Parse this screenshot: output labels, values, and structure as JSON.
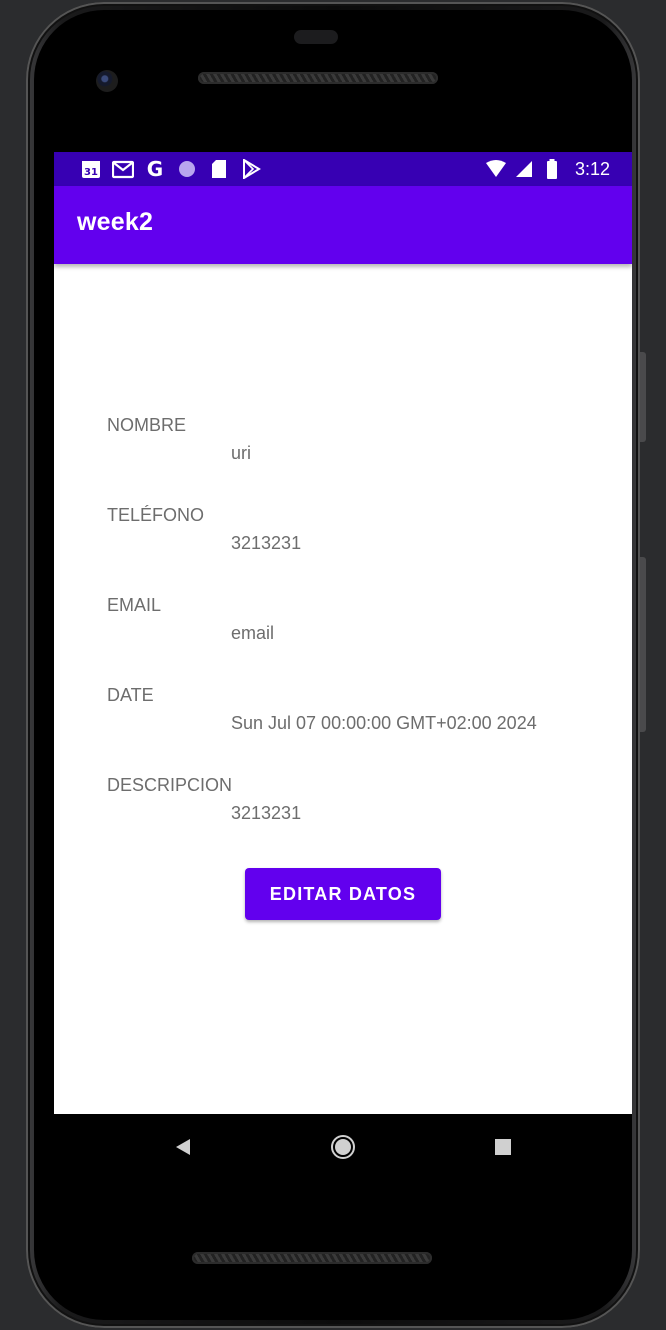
{
  "status_bar": {
    "time": "3:12",
    "left_icons": [
      "calendar-icon",
      "gmail-icon",
      "google-icon",
      "dot-icon",
      "sd-card-icon",
      "play-store-icon"
    ],
    "right_icons": [
      "wifi-icon",
      "signal-icon",
      "battery-icon"
    ],
    "google_letter": "G",
    "calendar_day": "31",
    "background": "#3700b3"
  },
  "app_bar": {
    "title": "week2",
    "background": "#6200ee"
  },
  "fields": [
    {
      "label": "NOMBRE",
      "value": "uri"
    },
    {
      "label": "TELÉFONO",
      "value": "3213231"
    },
    {
      "label": "EMAIL",
      "value": "email"
    },
    {
      "label": "DATE",
      "value": "Sun Jul 07 00:00:00 GMT+02:00 2024"
    },
    {
      "label": "DESCRIPCION",
      "value": "3213231"
    }
  ],
  "edit_button": {
    "label": "EDITAR DATOS",
    "color": "#6200ee"
  },
  "nav_bar": {
    "buttons": [
      "back-icon",
      "home-icon",
      "recents-icon"
    ]
  }
}
